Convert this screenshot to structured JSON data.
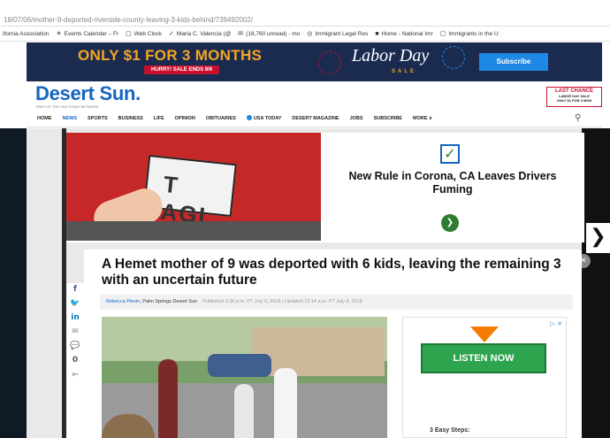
{
  "browser": {
    "url": "18/07/06/mother-9-deported-riverside-county-leaving-3-kids-behind/739492002/",
    "bookmarks": [
      {
        "icon": "",
        "label": "ifornia Association"
      },
      {
        "icon": "☀",
        "label": "Events Calendar – Fr"
      },
      {
        "icon": "▢",
        "label": "Web Clock"
      },
      {
        "icon": "✓",
        "label": "Maria C. Valencia (@"
      },
      {
        "icon": "✉",
        "label": "(18,760 unread) - mo"
      },
      {
        "icon": "◎",
        "label": "Immigrant Legal Res"
      },
      {
        "icon": "■",
        "label": "Home - National Imr"
      },
      {
        "icon": "▢",
        "label": "Immigrants in the U"
      }
    ]
  },
  "promo": {
    "offer": "ONLY $1 FOR 3 MONTHS",
    "sale_ends": "HURRY! SALE ENDS 9/6",
    "holiday": "Labor Day",
    "holiday_sub": "SALE",
    "subscribe": "Subscribe"
  },
  "masthead": {
    "logo": "Desert Sun.",
    "tagline": "PART OF THE USA TODAY NETWORK",
    "last_chance_title": "LAST CHANCE",
    "last_chance_line1": "LABOR DAY SALE",
    "last_chance_line2": "ONLY $1 FOR 3 MON"
  },
  "nav": {
    "items": [
      "HOME",
      "NEWS",
      "SPORTS",
      "BUSINESS",
      "LIFE",
      "OPINION",
      "OBITUARIES",
      "USA TODAY",
      "DESERT MAGAZINE",
      "JOBS",
      "SUBSCRIBE",
      "MORE"
    ],
    "active": "NEWS"
  },
  "ad": {
    "plate_text": "T AGI",
    "headline": "New Rule in Corona, CA Leaves Drivers Fuming"
  },
  "article": {
    "title": "A Hemet mother of 9 was deported with 6 kids, leaving the remaining 3 with an uncertain future",
    "author": "Rebecca Plevin",
    "organization": ", Palm Springs Desert Sun",
    "published": "Published 6:36 p.m. PT July 6, 2018",
    "updated": "| Updated 12:14 a.m. PT July 8, 2018"
  },
  "sidead": {
    "button": "LISTEN NOW",
    "steps": "3 Easy Steps:"
  },
  "social": [
    "f",
    "🐦",
    "in",
    "✉",
    "💬",
    "0",
    "⟜"
  ]
}
